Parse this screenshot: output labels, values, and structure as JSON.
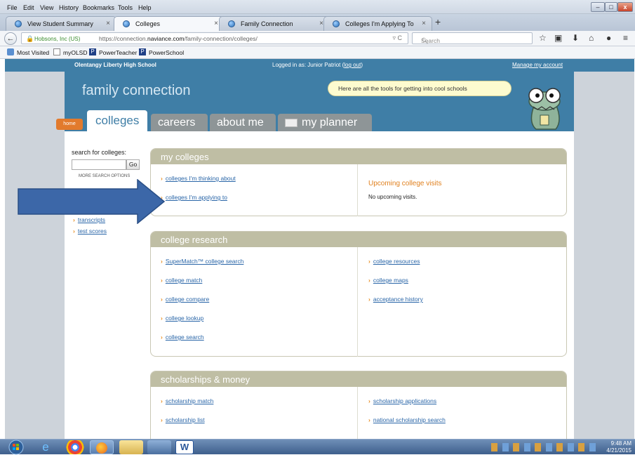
{
  "browser": {
    "menu": [
      "File",
      "Edit",
      "View",
      "History",
      "Bookmarks",
      "Tools",
      "Help"
    ],
    "tabs": [
      {
        "label": "View Student Summary"
      },
      {
        "label": "Colleges"
      },
      {
        "label": "Family Connection"
      },
      {
        "label": "Colleges I'm Applying To"
      }
    ],
    "site_identity": "Hobsons, Inc (US)",
    "url_prefix": "https://connection.",
    "url_domain": "naviance.com",
    "url_path": "/family-connection/colleges/",
    "search_placeholder": "Search",
    "bookmarks": [
      "Most Visited",
      "myOLSD",
      "PowerTeacher",
      "PowerSchool"
    ]
  },
  "site": {
    "school": "Olentangy Liberty High School",
    "logged_in_prefix": "Logged in as: Junior Patriot (",
    "logout": "log out",
    "logged_in_suffix": ")",
    "manage_account": "Manage my account",
    "title": "family connection",
    "bubble": "Here are all the tools for getting into cool schools",
    "home_tab": "home",
    "tabs": [
      "colleges",
      "careers",
      "about me",
      "my planner"
    ]
  },
  "sidebar": {
    "search_label": "search for colleges:",
    "go": "Go",
    "more_options": "MORE SEARCH OPTIONS",
    "links": [
      "transcripts",
      "test scores"
    ]
  },
  "my_colleges": {
    "title": "my colleges",
    "links": [
      "colleges I'm thinking about",
      "colleges I'm applying to"
    ],
    "visits_title": "Upcoming college visits",
    "visits_none": "No upcoming visits."
  },
  "college_research": {
    "title": "college research",
    "left": [
      "SuperMatch™ college search",
      "college match",
      "college compare",
      "college lookup",
      "college search"
    ],
    "right": [
      "college resources",
      "college maps",
      "acceptance history"
    ]
  },
  "scholarships": {
    "title": "scholarships & money",
    "left": [
      "scholarship match",
      "scholarship list"
    ],
    "right": [
      "scholarship applications",
      "national scholarship search"
    ]
  },
  "taskbar": {
    "time": "9:48 AM",
    "date": "4/21/2015"
  },
  "colors": {
    "header_blue": "#3f7ea6",
    "section_tan": "#bfbea4",
    "link_blue": "#2a66a8",
    "chevron_orange": "#e88a1a",
    "arrow_blue": "#3c67a8"
  }
}
